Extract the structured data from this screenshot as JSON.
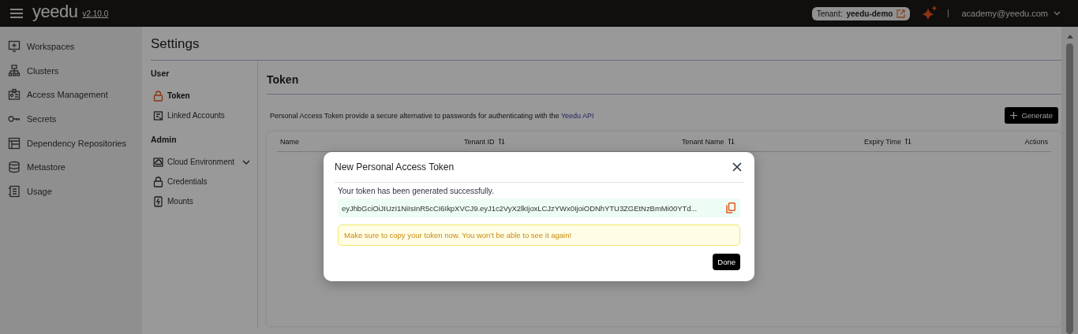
{
  "header": {
    "logo": "yeedu",
    "version": "v2.10.0",
    "tenant_label": "Tenant:",
    "tenant": "yeedu-demo",
    "user": "academy@yeedu.com"
  },
  "sidebar": {
    "items": [
      {
        "label": "Workspaces",
        "kind": "monitor"
      },
      {
        "label": "Clusters",
        "kind": "network"
      },
      {
        "label": "Access Management",
        "kind": "badge"
      },
      {
        "label": "Secrets",
        "kind": "key"
      },
      {
        "label": "Dependency Repositories",
        "kind": "repo"
      },
      {
        "label": "Metastore",
        "kind": "database"
      },
      {
        "label": "Usage",
        "kind": "report"
      }
    ]
  },
  "settings": {
    "title": "Settings",
    "groups": [
      {
        "title": "User",
        "items": [
          {
            "label": "Token",
            "kind": "lock",
            "selected": true,
            "has_submenu": false
          },
          {
            "label": "Linked Accounts",
            "kind": "link",
            "selected": false,
            "has_submenu": false
          }
        ]
      },
      {
        "title": "Admin",
        "items": [
          {
            "label": "Cloud Environment",
            "kind": "cloud",
            "selected": false,
            "has_submenu": true
          },
          {
            "label": "Credentials",
            "kind": "lock",
            "selected": false,
            "has_submenu": false
          },
          {
            "label": "Mounts",
            "kind": "drive",
            "selected": false,
            "has_submenu": false
          }
        ]
      }
    ]
  },
  "panel": {
    "title": "Token",
    "description": "Personal Access Token provide a secure alternative to passwords for authenticating with the",
    "link": "Yeedu API",
    "generate_button": "Generate",
    "table": {
      "columns": [
        {
          "label": "Name",
          "sortable": false
        },
        {
          "label": "Tenant ID",
          "sortable": true
        },
        {
          "label": "Tenant Name",
          "sortable": true
        },
        {
          "label": "Expiry Time",
          "sortable": true
        },
        {
          "label": "Actions",
          "sortable": false
        }
      ]
    }
  },
  "dialog": {
    "title": "New Personal Access Token",
    "message": "Your token has been generated successfully.",
    "token": "eyJhbGciOiJIUzI1NiIsInR5cCI6IkpXVCJ9.eyJ1c2VyX2lkIjoxLCJzYWx0IjoiODNhYTU3ZGEtNzBmMi00YTd...",
    "warning": "Make sure to copy your token now. You won't be able to see it again!",
    "done_button": "Done"
  }
}
